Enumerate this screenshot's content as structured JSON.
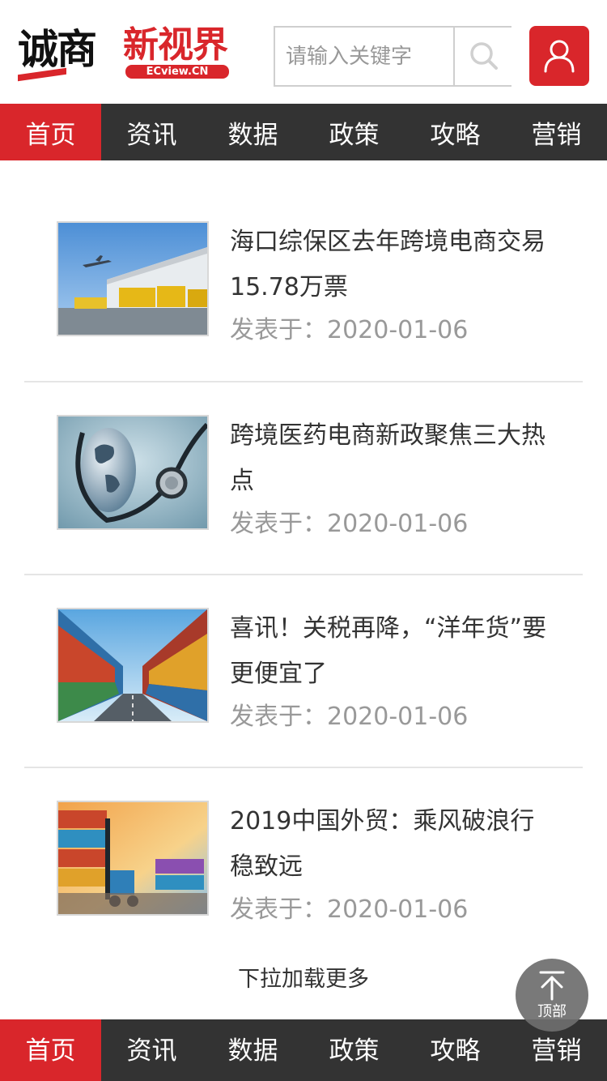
{
  "header": {
    "logo_main": "诚商",
    "logo_red": "新视界",
    "logo_badge": "ECview.CN",
    "search_placeholder": "请输入关键字"
  },
  "nav": {
    "items": [
      "首页",
      "资讯",
      "数据",
      "政策",
      "攻略",
      "营销"
    ],
    "active": "首页"
  },
  "articles": [
    {
      "title": "海口综保区去年跨境电商交易15.78万票",
      "date_prefix": "发表于：",
      "date": "2020-01-06",
      "thumb": "warehouse-airplane-image"
    },
    {
      "title": "跨境医药电商新政聚焦三大热点",
      "date_prefix": "发表于：",
      "date": "2020-01-06",
      "thumb": "globe-stethoscope-image"
    },
    {
      "title": "喜讯！关税再降，“洋年货”要更便宜了",
      "date_prefix": "发表于：",
      "date": "2020-01-06",
      "thumb": "container-road-image"
    },
    {
      "title": "2019中国外贸：乘风破浪行稳致远",
      "date_prefix": "发表于：",
      "date": "2020-01-06",
      "thumb": "container-forklift-image"
    }
  ],
  "load_more": "下拉加载更多",
  "back_to_top": "顶部",
  "colors": {
    "accent": "#d9262b",
    "nav_bg": "#333333",
    "muted_text": "#999999"
  }
}
